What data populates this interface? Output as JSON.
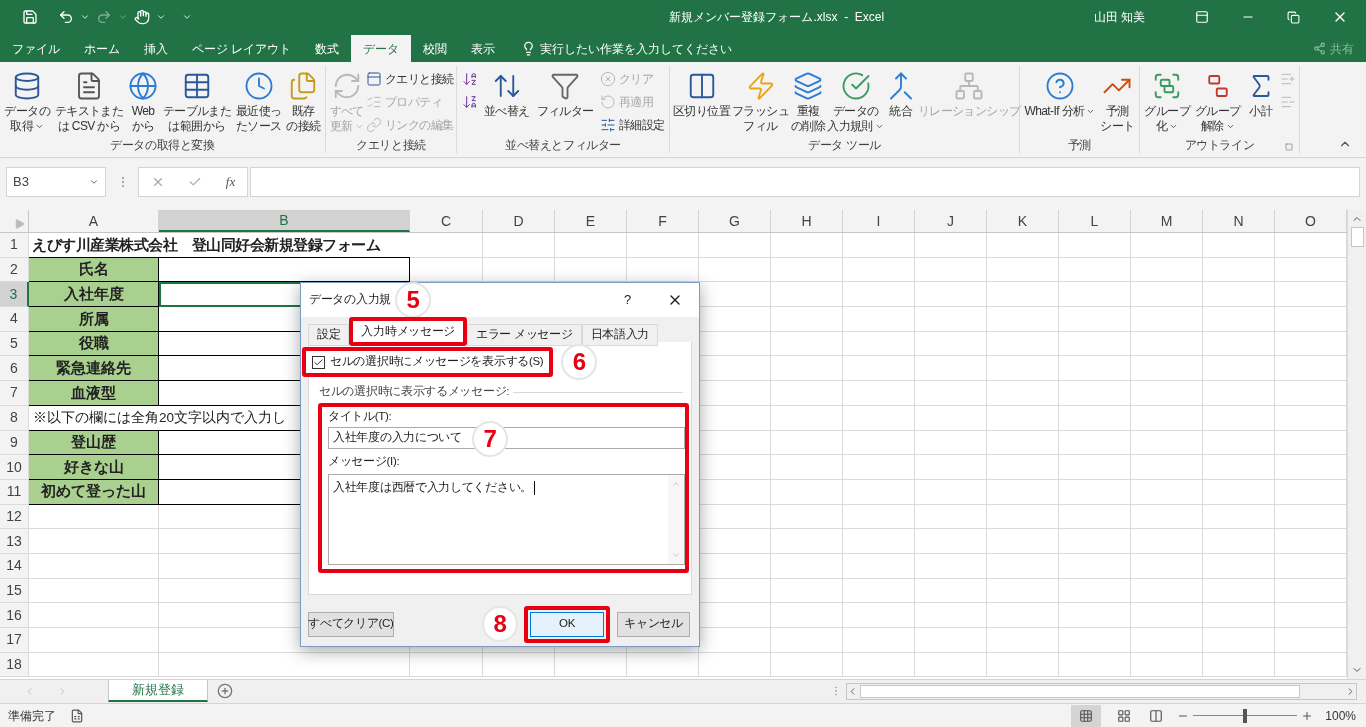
{
  "title_bar": {
    "title": "新規メンバー登録フォーム.xlsx  -  Excel",
    "user": "山田 知美"
  },
  "menu_tabs": [
    {
      "label": "ファイル",
      "selected": false
    },
    {
      "label": "ホーム",
      "selected": false
    },
    {
      "label": "挿入",
      "selected": false
    },
    {
      "label": "ページ レイアウト",
      "selected": false
    },
    {
      "label": "数式",
      "selected": false
    },
    {
      "label": "データ",
      "selected": true
    },
    {
      "label": "校閲",
      "selected": false
    },
    {
      "label": "表示",
      "selected": false
    }
  ],
  "tell_me": "実行したい作業を入力してください",
  "share": "共有",
  "ribbon_groups": [
    {
      "label": "データの取得と変換",
      "items": [
        {
          "kind": "large",
          "lines": [
            "データの",
            "取得"
          ],
          "dropdown": true,
          "disabled": false
        },
        {
          "kind": "large",
          "lines": [
            "テキストまた",
            "は CSV から"
          ],
          "dropdown": false,
          "disabled": false
        },
        {
          "kind": "large",
          "lines": [
            "Web",
            "から"
          ],
          "dropdown": false,
          "disabled": false
        },
        {
          "kind": "large",
          "lines": [
            "テーブルまた",
            "は範囲から"
          ],
          "dropdown": false,
          "disabled": false
        },
        {
          "kind": "large",
          "lines": [
            "最近使っ",
            "たソース"
          ],
          "dropdown": false,
          "disabled": false
        },
        {
          "kind": "large",
          "lines": [
            "既存",
            "の接続"
          ],
          "dropdown": false,
          "disabled": false
        }
      ]
    },
    {
      "label": "クエリと接続",
      "items": [
        {
          "kind": "large",
          "lines": [
            "すべて",
            "更新"
          ],
          "dropdown": true,
          "disabled": true
        },
        {
          "kind": "stack",
          "items": [
            {
              "label": "クエリと接続",
              "disabled": false
            },
            {
              "label": "プロパティ",
              "disabled": true
            },
            {
              "label": "リンクの編集",
              "disabled": true
            }
          ]
        }
      ]
    },
    {
      "label": "並べ替えとフィルター",
      "items": [
        {
          "kind": "stack",
          "items": [
            {
              "disabled": false
            },
            {
              "disabled": false
            }
          ]
        },
        {
          "kind": "large",
          "lines": [
            "並べ替え"
          ],
          "dropdown": false,
          "disabled": false
        },
        {
          "kind": "large",
          "lines": [
            "フィルター"
          ],
          "dropdown": false,
          "disabled": false
        },
        {
          "kind": "stack",
          "items": [
            {
              "label": "クリア",
              "disabled": true
            },
            {
              "label": "再適用",
              "disabled": true
            },
            {
              "label": "詳細設定",
              "disabled": false
            }
          ]
        }
      ]
    },
    {
      "label": "データ ツール",
      "items": [
        {
          "kind": "large",
          "lines": [
            "区切り位置"
          ],
          "dropdown": false,
          "disabled": false
        },
        {
          "kind": "large",
          "lines": [
            "フラッシュ",
            "フィル"
          ],
          "dropdown": false,
          "disabled": false
        },
        {
          "kind": "large",
          "lines": [
            "重複",
            "の削除"
          ],
          "dropdown": false,
          "disabled": false
        },
        {
          "kind": "large",
          "lines": [
            "データの",
            "入力規則"
          ],
          "dropdown": true,
          "disabled": false
        },
        {
          "kind": "large",
          "lines": [
            "統合"
          ],
          "dropdown": false,
          "disabled": false
        },
        {
          "kind": "large",
          "lines": [
            "リレーションシップ"
          ],
          "dropdown": false,
          "disabled": true
        }
      ]
    },
    {
      "label": "予測",
      "items": [
        {
          "kind": "large",
          "lines": [
            "What-If 分析"
          ],
          "dropdown": true,
          "disabled": false
        },
        {
          "kind": "large",
          "lines": [
            "予測",
            "シート"
          ],
          "dropdown": false,
          "disabled": false
        }
      ]
    },
    {
      "label": "アウトライン",
      "launcher": true,
      "items": [
        {
          "kind": "large",
          "lines": [
            "グループ",
            "化"
          ],
          "dropdown": true,
          "disabled": false
        },
        {
          "kind": "large",
          "lines": [
            "グループ",
            "解除"
          ],
          "dropdown": true,
          "disabled": false
        },
        {
          "kind": "large",
          "lines": [
            "小計"
          ],
          "dropdown": false,
          "disabled": false
        },
        {
          "kind": "stack",
          "items": [
            {
              "disabled": true
            },
            {
              "disabled": true
            }
          ]
        }
      ]
    }
  ],
  "formula_bar": {
    "name_box": "B3",
    "function_button": "fx"
  },
  "columns": [
    {
      "label": "A",
      "selected": false
    },
    {
      "label": "B",
      "selected": true
    },
    {
      "label": "C",
      "selected": false
    },
    {
      "label": "D",
      "selected": false
    },
    {
      "label": "E",
      "selected": false
    },
    {
      "label": "F",
      "selected": false
    },
    {
      "label": "G",
      "selected": false
    },
    {
      "label": "H",
      "selected": false
    },
    {
      "label": "I",
      "selected": false
    },
    {
      "label": "J",
      "selected": false
    },
    {
      "label": "K",
      "selected": false
    },
    {
      "label": "L",
      "selected": false
    },
    {
      "label": "M",
      "selected": false
    },
    {
      "label": "N",
      "selected": false
    },
    {
      "label": "O",
      "selected": false
    }
  ],
  "rows": [
    {
      "number": "1",
      "selected": false,
      "kind": "title",
      "text": "えびす川産業株式会社　登山同好会新規登録フォーム"
    },
    {
      "number": "2",
      "selected": false,
      "kind": "field",
      "text": "氏名"
    },
    {
      "number": "3",
      "selected": true,
      "kind": "field",
      "text": "入社年度"
    },
    {
      "number": "4",
      "selected": false,
      "kind": "field",
      "text": "所属"
    },
    {
      "number": "5",
      "selected": false,
      "kind": "field",
      "text": "役職"
    },
    {
      "number": "6",
      "selected": false,
      "kind": "field",
      "text": "緊急連絡先"
    },
    {
      "number": "7",
      "selected": false,
      "kind": "field",
      "text": "血液型"
    },
    {
      "number": "8",
      "selected": false,
      "kind": "note",
      "text": "※以下の欄には全角20文字以内で入力し"
    },
    {
      "number": "9",
      "selected": false,
      "kind": "field",
      "text": "登山歴"
    },
    {
      "number": "10",
      "selected": false,
      "kind": "field",
      "text": "好きな山"
    },
    {
      "number": "11",
      "selected": false,
      "kind": "field",
      "text": "初めて登った山"
    },
    {
      "number": "12",
      "selected": false,
      "kind": "empty"
    },
    {
      "number": "13",
      "selected": false,
      "kind": "empty"
    },
    {
      "number": "14",
      "selected": false,
      "kind": "empty"
    },
    {
      "number": "15",
      "selected": false,
      "kind": "empty"
    },
    {
      "number": "16",
      "selected": false,
      "kind": "empty"
    },
    {
      "number": "17",
      "selected": false,
      "kind": "empty"
    },
    {
      "number": "18",
      "selected": false,
      "kind": "empty"
    }
  ],
  "sheet_tabs": [
    {
      "label": "新規登録",
      "selected": true
    }
  ],
  "status_bar": {
    "status": "準備完了",
    "zoom": {
      "level": 0.5,
      "reading": "100%"
    }
  },
  "dialog": {
    "title": "データの入力規",
    "help": "?",
    "tabs": [
      {
        "label": "設定",
        "selected": false
      },
      {
        "label": "入力時メッセージ",
        "selected": true
      },
      {
        "label": "エラー メッセージ",
        "selected": false
      },
      {
        "label": "日本語入力",
        "selected": false
      }
    ],
    "show_message": {
      "label": "セルの選択時にメッセージを表示する(S)",
      "checked": true
    },
    "section_label": "セルの選択時に表示するメッセージ:",
    "title_label": "タイトル(T):",
    "title_value": "入社年度の入力について",
    "message_label": "メッセージ(I):",
    "message_value": "入社年度は西暦で入力してください。",
    "buttons": [
      {
        "label": "すべてクリア(C)",
        "kind": "clear"
      },
      {
        "label": "OK",
        "kind": "ok"
      },
      {
        "label": "キャンセル",
        "kind": "cancel"
      }
    ]
  },
  "annotations": [
    "5",
    "6",
    "7",
    "8"
  ]
}
